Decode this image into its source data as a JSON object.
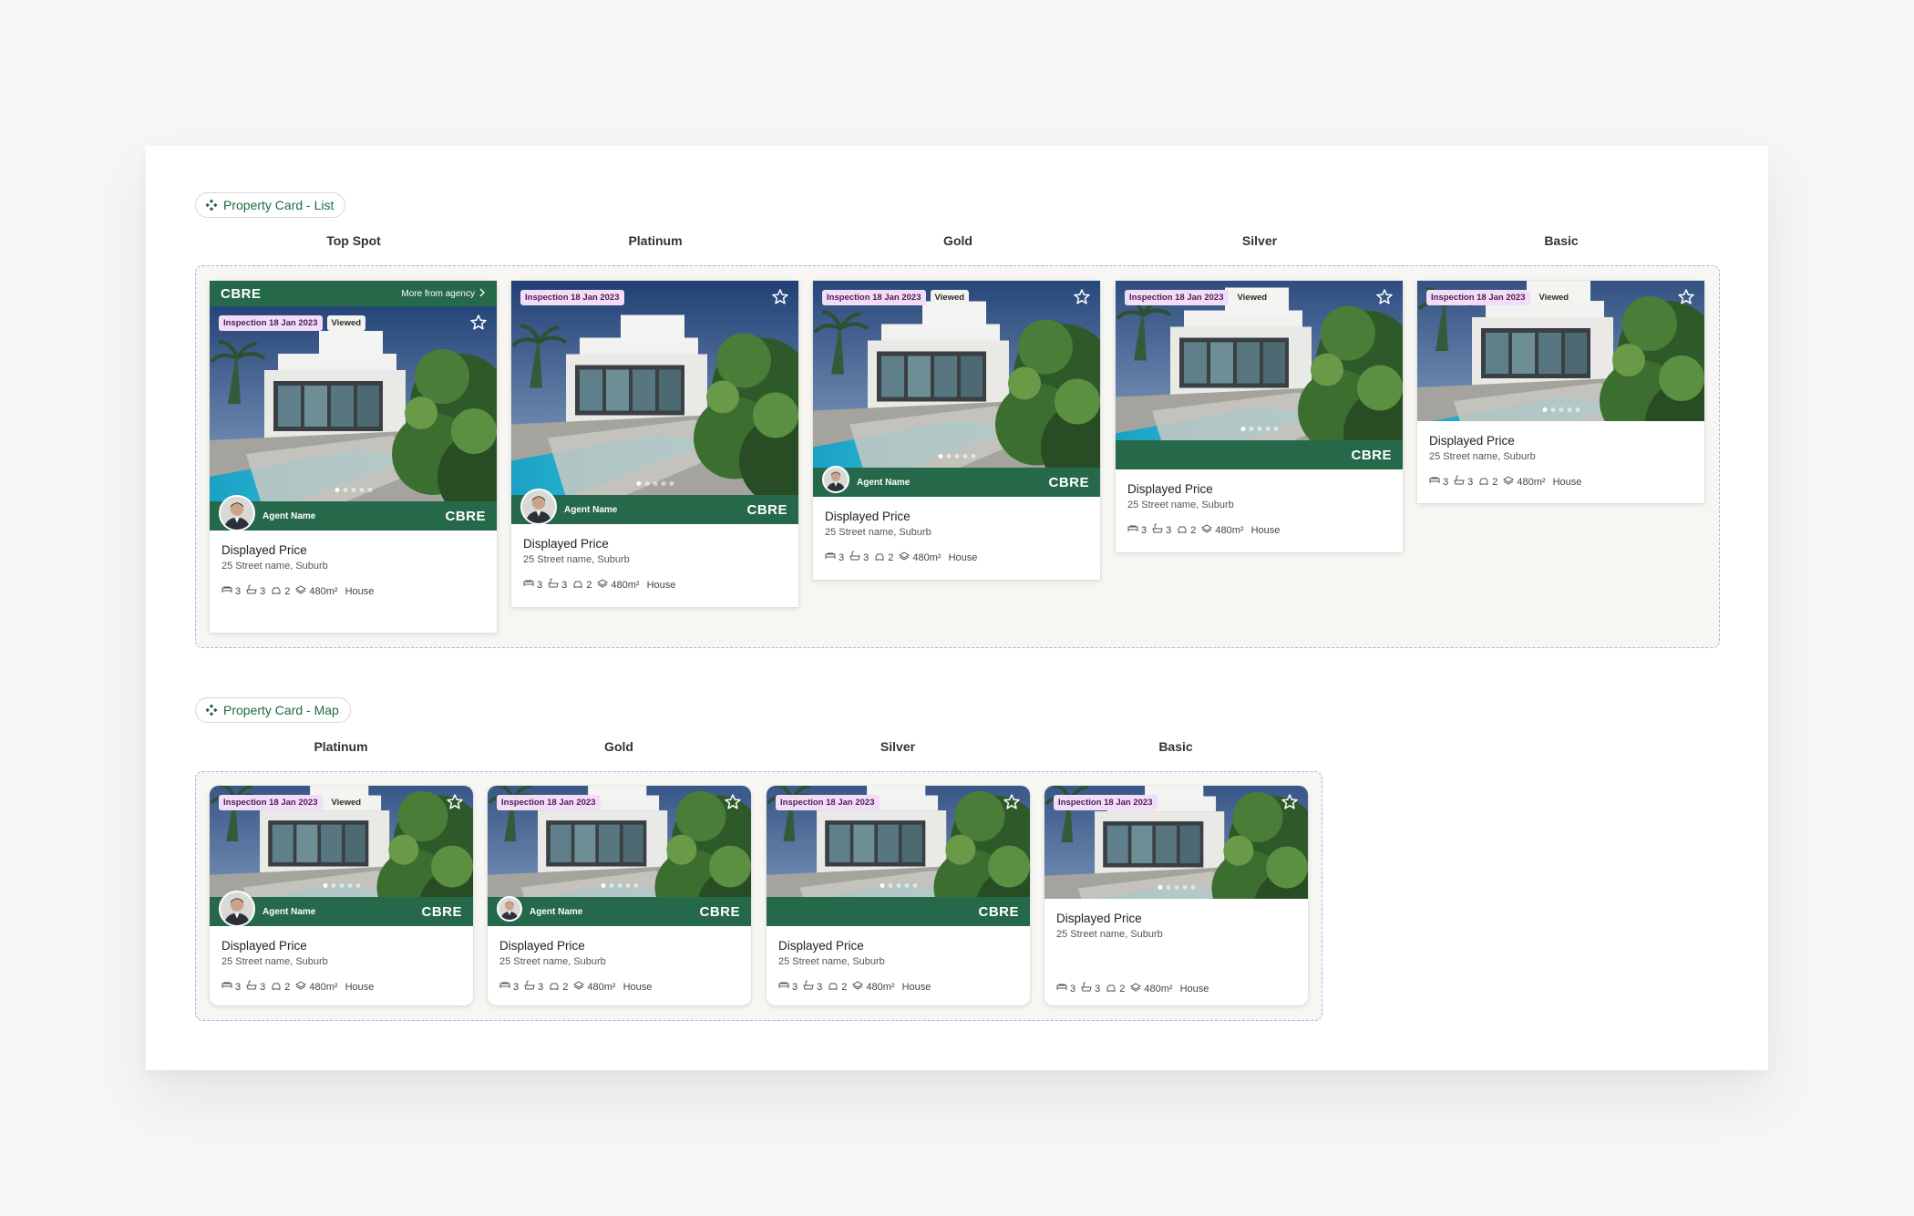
{
  "list_section": {
    "chip_label": "Property Card - List",
    "columns": [
      "Top Spot",
      "Platinum",
      "Gold",
      "Silver",
      "Basic"
    ]
  },
  "map_section": {
    "chip_label": "Property Card - Map",
    "columns": [
      "Platinum",
      "Gold",
      "Silver",
      "Basic"
    ]
  },
  "card": {
    "logo": "CBRE",
    "more_from_agency": "More from agency",
    "inspection": "Inspection 18 Jan 2023",
    "viewed": "Viewed",
    "agent_name": "Agent Name",
    "price": "Displayed Price",
    "address": "25 Street name, Suburb",
    "beds": "3",
    "baths": "3",
    "cars": "2",
    "area": "480m²",
    "property_type": "House"
  },
  "colors": {
    "brand_green": "#25694a",
    "inspection_badge": "#f3dcf7",
    "frame_dash": "#c3a6e6"
  }
}
